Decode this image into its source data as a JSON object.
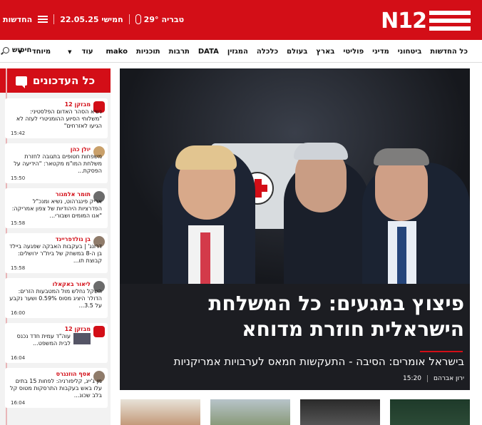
{
  "header": {
    "logo_text": "N12",
    "date": "חמישי 22.05.25",
    "weather_city": "טבריה",
    "weather_temp": "29°",
    "menu_label": "החדשות",
    "brand_color": "#d30e17"
  },
  "nav": {
    "items": [
      "כל החדשות",
      "ביטחוני",
      "מדיני",
      "פוליטי",
      "בארץ",
      "בעולם",
      "כלכלה",
      "המגזין",
      "DATA",
      "תרבות",
      "תוכניות",
      "mako",
      "עוד",
      "מיוחד"
    ],
    "search_label": "חיפוש"
  },
  "sidebar": {
    "title": "כל העדכונים",
    "items": [
      {
        "author": "מבזקן 12",
        "text": "נשיא הסהר האדום הפלסטיני: \"משלוחי הסיוע ההומניטרי לעזה לא הגיעו לאזרחים\"",
        "time": "15:42",
        "avatar": "red"
      },
      {
        "author": "יולן כהן",
        "text": "משפחות חטופים בתגובה לחזרת משלחת המו\"מ מקטאר: \"הידיעה על הפסקת...",
        "time": "15:50",
        "avatar": "photo1"
      },
      {
        "author": "תומר אלמגור",
        "text": "אריק פינגרהוט, נשיא ומנכ\"ל הפדרציות היהודיות של צפון אמריקה: \"אנו המומים ושבורי...",
        "time": "15:58",
        "avatar": "photo2"
      },
      {
        "author": "בן גולדפריינד",
        "text": "דרונג' | בעקבות האבקה שפגעה ביילד בן ה-8 במשחק של בית\"ר ירושלים: קבוצת תו...",
        "time": "15:58",
        "avatar": "photo3"
      },
      {
        "author": "ליאור באקאלו",
        "text": "השקל נחלש מול המטבעות הזרים: הדולר היציג מסוס 0.59% ושער נקבע על 3.5...",
        "time": "16:00",
        "avatar": "photo2"
      },
      {
        "author": "מבזקן 12",
        "text": "עוה\"ד עמית חדד נכנס לבית המשפט...",
        "time": "16:04",
        "avatar": "red"
      },
      {
        "author": "אסף הוזנגרס",
        "text": "מן ג'ייג, קליפורניה: לפחות 15 בתים עלו באש בעקבות התרסקות מטוס קל בלב שכונ...",
        "time": "16:04",
        "avatar": "photo3"
      }
    ]
  },
  "hero": {
    "title": "פיצוץ במגעים: כל המשלחת הישראלית חוזרת מדוחא",
    "subtitle": "בישראל אומרים: הסיבה - התעקשות חמאס לערבויות אמריקניות",
    "author": "ירון אברהם",
    "time": "15:20"
  }
}
